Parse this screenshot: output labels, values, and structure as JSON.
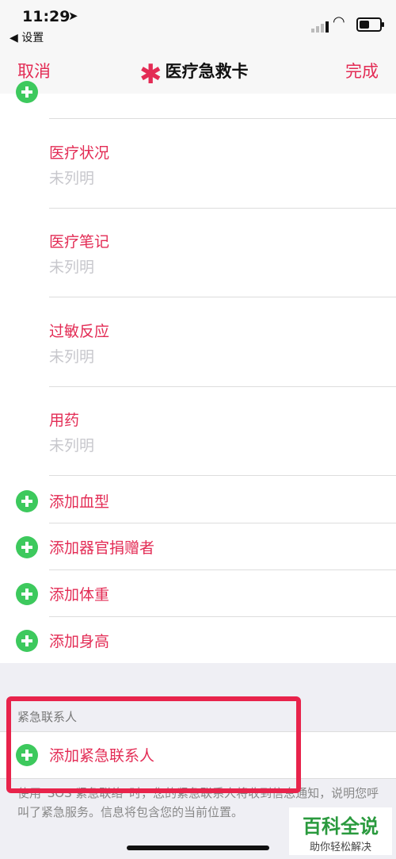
{
  "status": {
    "time": "11:29",
    "back_label": "设置"
  },
  "nav": {
    "cancel": "取消",
    "title": "医疗急救卡",
    "done": "完成"
  },
  "fields": [
    {
      "title": "医疗状况",
      "value": "未列明"
    },
    {
      "title": "医疗笔记",
      "value": "未列明"
    },
    {
      "title": "过敏反应",
      "value": "未列明"
    },
    {
      "title": "用药",
      "value": "未列明"
    }
  ],
  "add_items": [
    "添加血型",
    "添加器官捐赠者",
    "添加体重",
    "添加身高"
  ],
  "emergency": {
    "section_header": "紧急联系人",
    "add_label": "添加紧急联系人",
    "note": "使用“SOS 紧急联络”时，您的紧急联系人将收到信息通知，说明您呼叫了紧急服务。信息将包含您的当前位置。"
  },
  "watermark": {
    "title": "百科全说",
    "subtitle": "助你轻松解决"
  },
  "colors": {
    "accent": "#e32c55",
    "add_green": "#3dc95d",
    "highlight": "#e8234b"
  }
}
